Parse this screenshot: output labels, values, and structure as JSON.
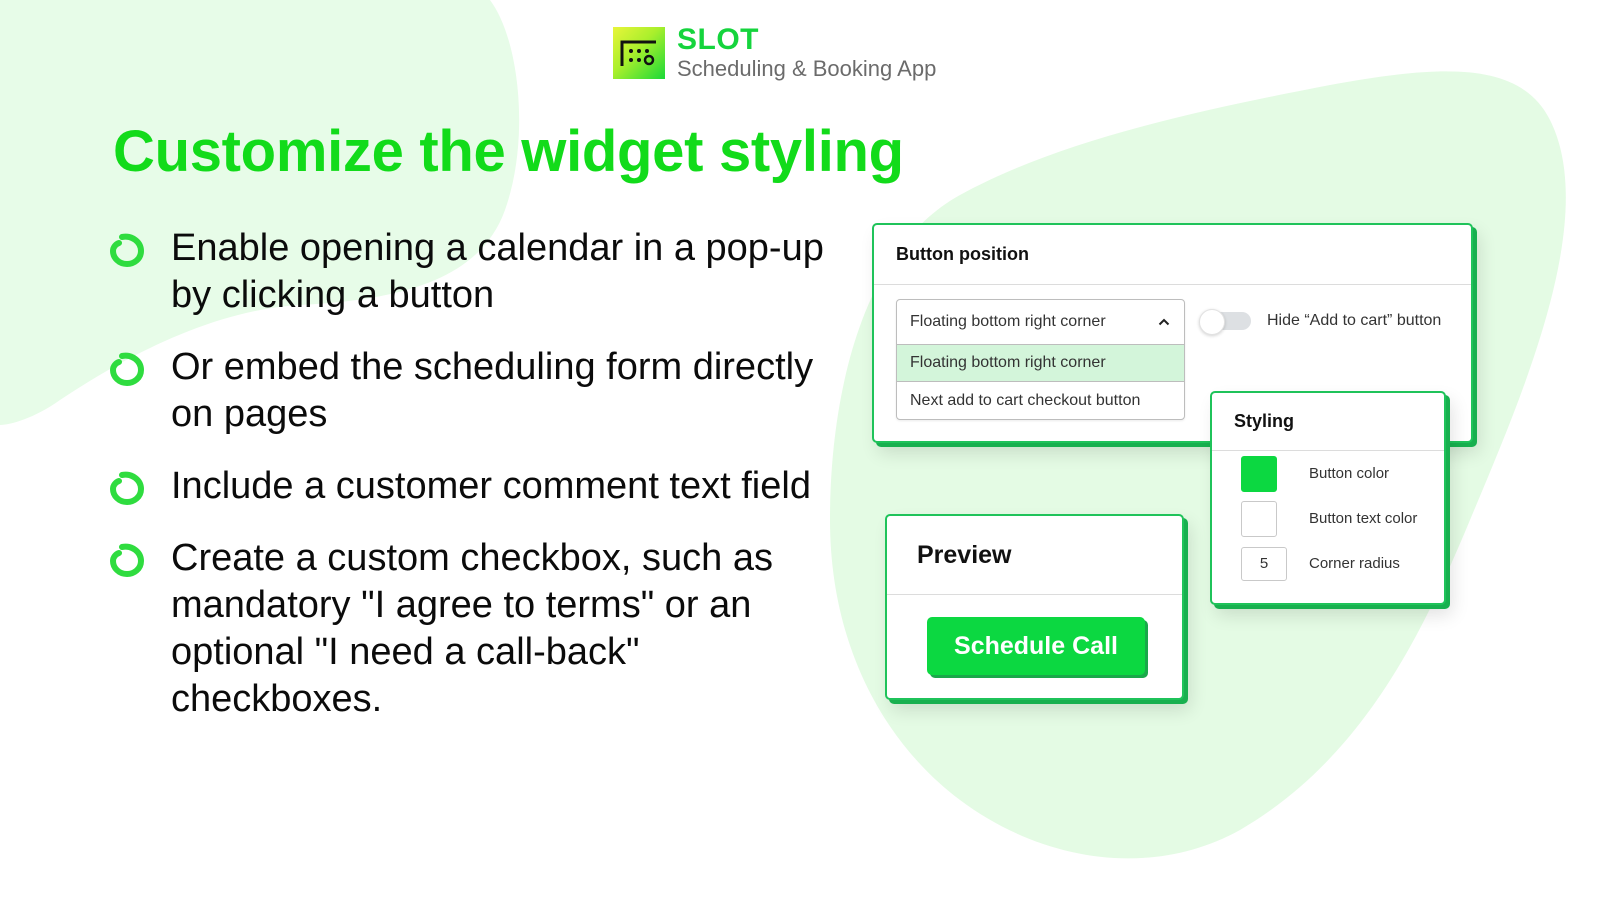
{
  "brand": {
    "logo_icon": "calendar-grid-icon",
    "name": "SLOT",
    "subtitle": "Scheduling & Booking App"
  },
  "headline": "Customize the widget styling",
  "features": [
    {
      "icon": "ring-bullet-icon",
      "text": "Enable opening a calendar in a pop-up by clicking a button"
    },
    {
      "icon": "ring-bullet-icon",
      "text": "Or embed the scheduling form directly on pages"
    },
    {
      "icon": "ring-bullet-icon",
      "text": "Include a customer comment text field"
    },
    {
      "icon": "ring-bullet-icon",
      "text": "Create a custom checkbox, such as mandatory \"I agree to terms\" or an optional \"I need a call-back\" checkboxes."
    }
  ],
  "button_position": {
    "title": "Button position",
    "select": {
      "current": "Floating bottom right corner",
      "expanded": true,
      "options": [
        {
          "label": "Floating bottom right corner",
          "selected": true
        },
        {
          "label": "Next add to cart checkout button",
          "selected": false
        }
      ]
    },
    "toggle": {
      "label": "Hide “Add to cart” button",
      "on": false
    }
  },
  "styling": {
    "title": "Styling",
    "button_color": {
      "label": "Button color",
      "value": "#0cd841"
    },
    "button_text_color": {
      "label": "Button text color",
      "value": "#ffffff"
    },
    "corner_radius": {
      "label": "Corner radius",
      "value": "5"
    }
  },
  "preview": {
    "title": "Preview",
    "button_label": "Schedule Call"
  },
  "colors": {
    "brand_green": "#12db1a",
    "accent_green": "#0cd841",
    "card_border": "#1fc35a",
    "blob": "#e6fbe6",
    "selected_option": "#d3f5da"
  }
}
